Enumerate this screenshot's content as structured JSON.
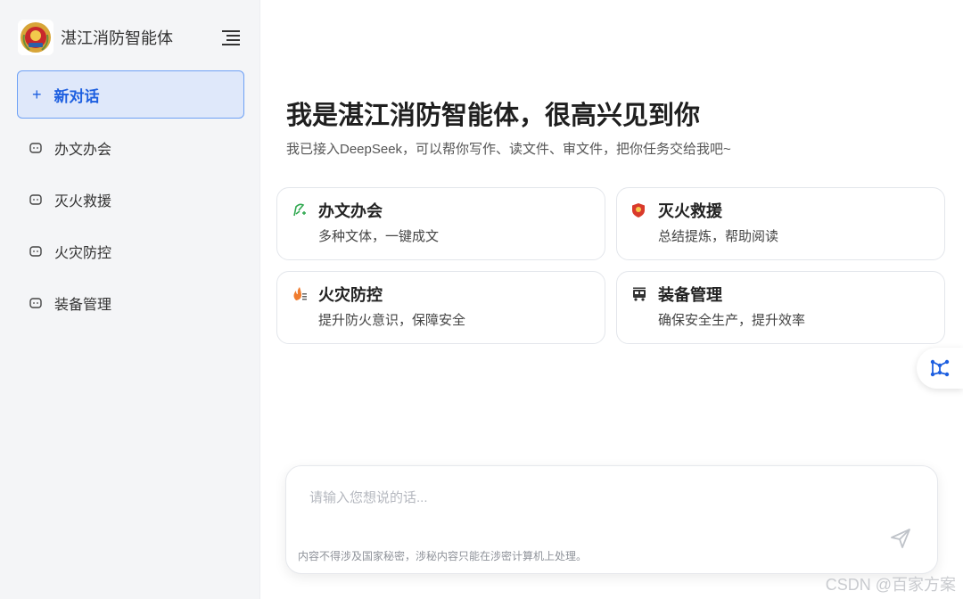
{
  "sidebar": {
    "brand_title": "湛江消防智能体",
    "new_chat_label": "新对话",
    "new_chat_icon": "+",
    "items": [
      {
        "label": "办文办会",
        "icon": "chat-bubble-icon"
      },
      {
        "label": "灭火救援",
        "icon": "chat-bubble-icon"
      },
      {
        "label": "火灾防控",
        "icon": "chat-bubble-icon"
      },
      {
        "label": "装备管理",
        "icon": "chat-bubble-icon"
      }
    ]
  },
  "main": {
    "greeting": "我是湛江消防智能体，很高兴见到你",
    "subtitle": "我已接入DeepSeek，可以帮你写作、读文件、审文件，把你任务交给我吧~",
    "cards": [
      {
        "title": "办文办会",
        "desc": "多种文体，一键成文",
        "icon": "quill-icon"
      },
      {
        "title": "灭火救援",
        "desc": "总结提炼，帮助阅读",
        "icon": "shield-icon"
      },
      {
        "title": "火灾防控",
        "desc": "提升防火意识，保障安全",
        "icon": "flame-icon"
      },
      {
        "title": "装备管理",
        "desc": "确保安全生产，提升效率",
        "icon": "fire-truck-icon"
      }
    ]
  },
  "composer": {
    "placeholder": "请输入您想说的话...",
    "disclaimer": "内容不得涉及国家秘密，涉秘内容只能在涉密计算机上处理。"
  },
  "watermark": "CSDN @百家方案",
  "colors": {
    "accent": "#1d5fe0",
    "sidebar_bg": "#f4f5f7",
    "new_chat_bg": "#dfe8fa"
  }
}
